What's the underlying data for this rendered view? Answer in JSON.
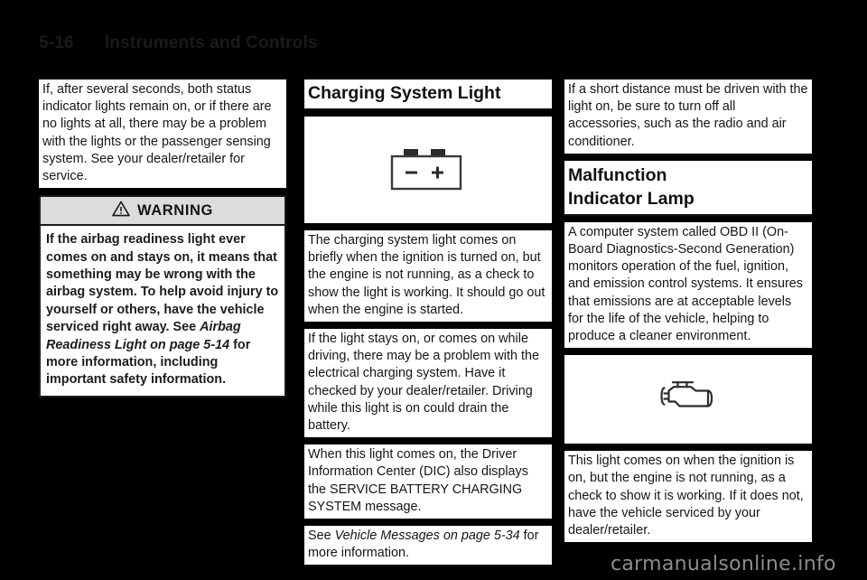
{
  "header": {
    "page_number": "5-16",
    "title": "Instruments and Controls"
  },
  "column1": {
    "intro_paragraph": "If, after several seconds, both status indicator lights remain on, or if there are no lights at all, there may be a problem with the lights or the passenger sensing system. See your dealer/retailer for service.",
    "warning": {
      "icon": "warning-triangle-icon",
      "label": "WARNING",
      "text_part1": "If the airbag readiness light ever comes on and stays on, it means that something may be wrong with the airbag system. To help avoid injury to yourself or others, have the vehicle serviced right away. See ",
      "text_italic": "Airbag Readiness Light on page 5-14",
      "text_part2": " for more information, including important safety information."
    }
  },
  "column2": {
    "heading": "Charging System Light",
    "figure": {
      "icon": "battery-icon",
      "minus_label": "−",
      "plus_label": "+"
    },
    "paragraph1": "The charging system light comes on briefly when the ignition is turned on, but the engine is not running, as a check to show the light is working. It should go out when the engine is started.",
    "paragraph2": "If the light stays on, or comes on while driving, there may be a problem with the electrical charging system. Have it checked by your dealer/retailer. Driving while this light is on could drain the battery.",
    "paragraph3": "When this light comes on, the Driver Information Center (DIC) also displays the SERVICE BATTERY CHARGING SYSTEM message.",
    "paragraph4_part1": "See ",
    "paragraph4_italic": "Vehicle Messages on page 5-34",
    "paragraph4_part2": " for more information."
  },
  "column3": {
    "paragraph1": "If a short distance must be driven with the light on, be sure to turn off all accessories, such as the radio and air conditioner.",
    "heading": "Malfunction\nIndicator Lamp",
    "heading_line1": "Malfunction",
    "heading_line2": "Indicator Lamp",
    "paragraph2": "A computer system called OBD II (On-Board Diagnostics-Second Generation) monitors operation of the fuel, ignition, and emission control systems. It ensures that emissions are at acceptable levels for the life of the vehicle, helping to produce a cleaner environment.",
    "figure": {
      "icon": "engine-malfunction-icon"
    },
    "paragraph3": "This light comes on when the ignition is on, but the engine is not running, as a check to show it is working. If it does not, have the vehicle serviced by your dealer/retailer."
  },
  "footer": {
    "watermark": "carmanualsonline.info"
  },
  "colors": {
    "page_background": "#000000",
    "content_background": "#ffffff",
    "text": "#161616",
    "warning_bar": "#dcdcdc",
    "watermark": "#8d8d8d"
  }
}
